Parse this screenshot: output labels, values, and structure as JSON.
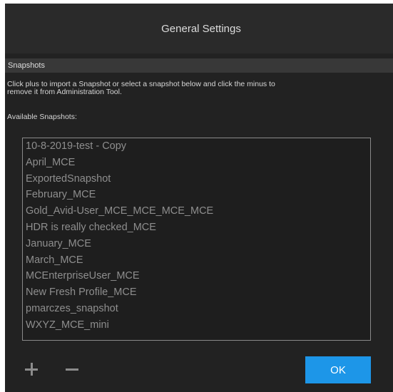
{
  "dialog": {
    "title": "General Settings"
  },
  "section": {
    "header": "Snapshots",
    "description_line1": "Click plus to import a Snapshot or select a snapshot below and click the minus to",
    "description_line2": "remove it from Administration Tool.",
    "available_label": "Available Snapshots:"
  },
  "snapshots": [
    "10-8-2019-test - Copy",
    "April_MCE",
    "ExportedSnapshot",
    "February_MCE",
    "Gold_Avid-User_MCE_MCE_MCE_MCE",
    "HDR is really checked_MCE",
    "January_MCE",
    "March_MCE",
    "MCEnterpriseUser_MCE",
    "New Fresh Profile_MCE",
    "pmarczes_snapshot",
    "WXYZ_MCE_mini"
  ],
  "buttons": {
    "add_icon": "plus-icon",
    "remove_icon": "minus-icon",
    "ok_label": "OK"
  },
  "colors": {
    "accent": "#1d96e8",
    "background": "#222222",
    "section_header": "#383838"
  }
}
